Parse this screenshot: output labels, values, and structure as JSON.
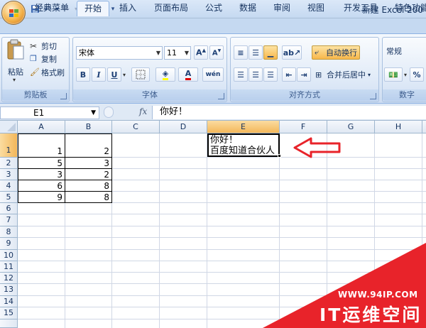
{
  "title_bar": {
    "title": "新建 Excel 200"
  },
  "tabs": [
    "经典菜单",
    "开始",
    "插入",
    "页面布局",
    "公式",
    "数据",
    "审阅",
    "视图",
    "开发工具",
    "特色功能"
  ],
  "clipboard": {
    "paste": "粘贴",
    "cut": "剪切",
    "copy": "复制",
    "format_painter": "格式刷",
    "group": "剪贴板"
  },
  "font_group": {
    "font_name": "宋体",
    "font_size": "11",
    "group": "字体",
    "bold": "B",
    "italic": "I",
    "underline": "U"
  },
  "alignment_group": {
    "wrap_text": "自动换行",
    "merge_center": "合并后居中",
    "group": "对齐方式"
  },
  "number_group": {
    "format": "常规",
    "percent": "%",
    "group": "数字"
  },
  "formula_bar": {
    "name_box": "E1",
    "fx": "fx",
    "content": "你好！"
  },
  "columns": [
    "A",
    "B",
    "C",
    "D",
    "E",
    "F",
    "G",
    "H"
  ],
  "rows": [
    "1",
    "2",
    "3",
    "4",
    "5",
    "6",
    "7",
    "8",
    "9",
    "10",
    "11",
    "12",
    "13",
    "14",
    "15"
  ],
  "table": [
    {
      "a": "1",
      "b": "2"
    },
    {
      "a": "5",
      "b": "3"
    },
    {
      "a": "3",
      "b": "2"
    },
    {
      "a": "6",
      "b": "8"
    },
    {
      "a": "9",
      "b": "8"
    }
  ],
  "e1_lines": [
    "你好！",
    "百度知道合伙人"
  ],
  "watermark": {
    "url": "WWW.94IP.COM",
    "name": "IT运维空间"
  },
  "colors": {
    "arrow": "#e8232a",
    "watermark_bg": "#e8232a",
    "selected_header": "#f3b75a"
  }
}
